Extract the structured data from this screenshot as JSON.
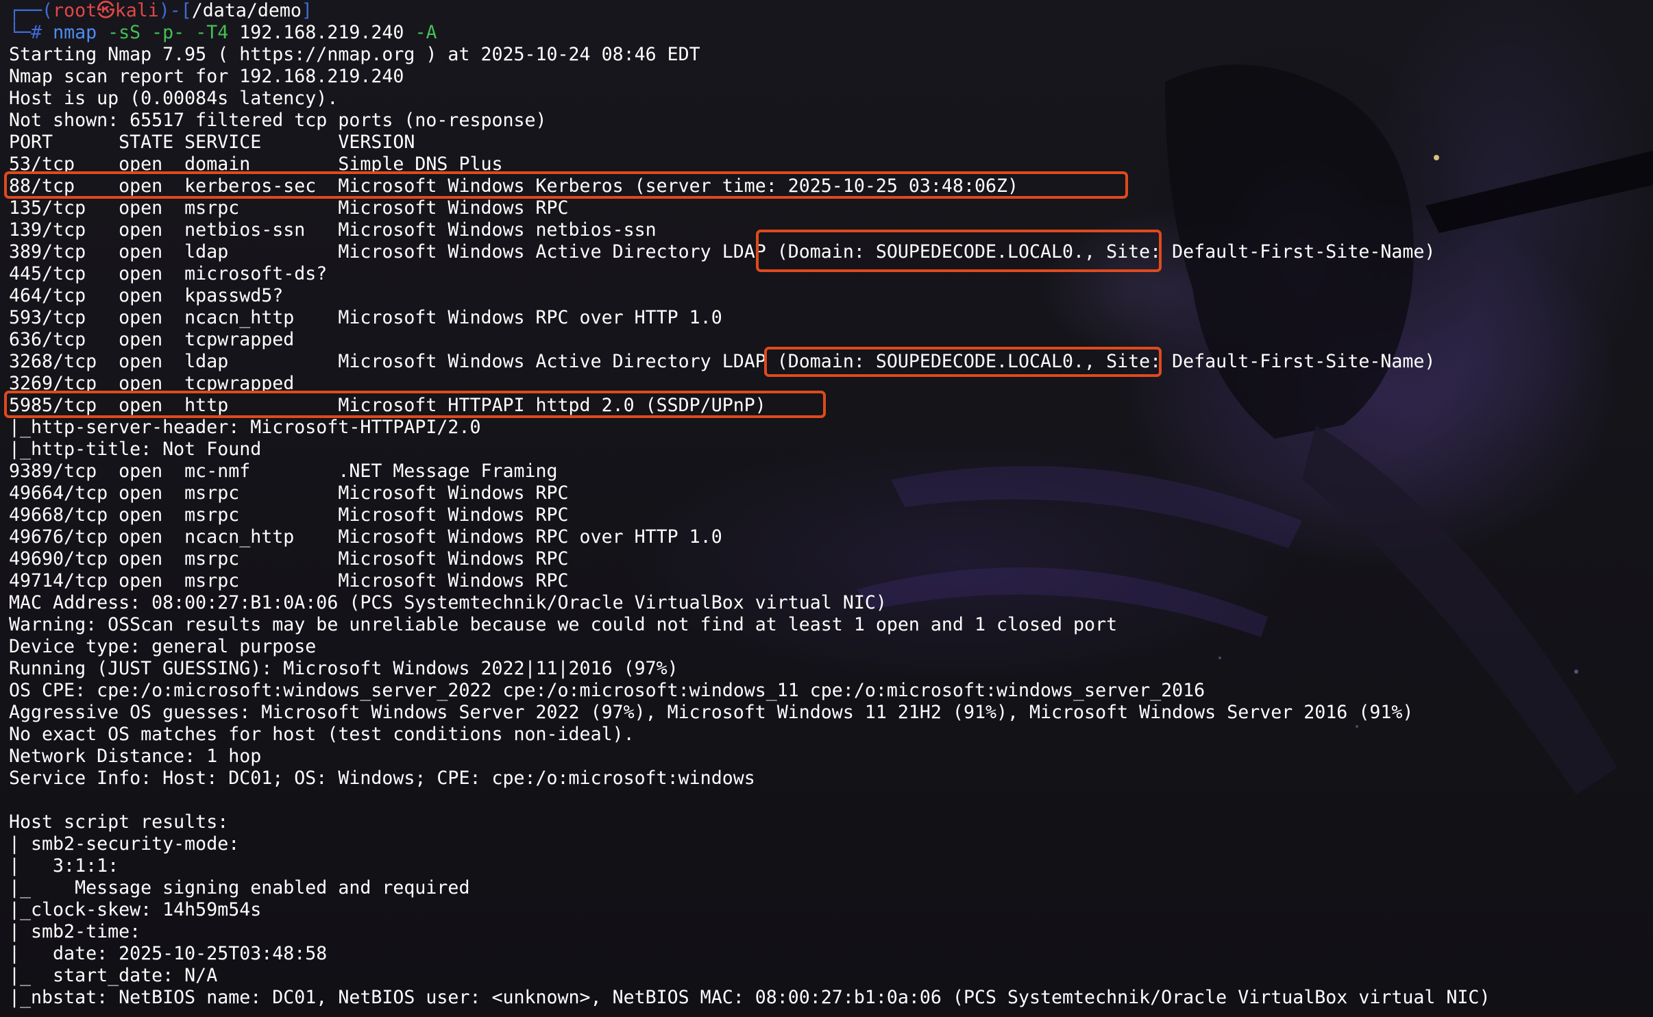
{
  "prompt": {
    "frame_top": "┌──(",
    "user": "root",
    "skull": "㉿",
    "host": "kali",
    "frame_mid": ")-[",
    "path": "/data/demo",
    "frame_end": "]",
    "frame_bottom": "└─",
    "hash": "# ",
    "command": "nmap",
    "flags": " -sS -p- -T4",
    "target": " 192.168.219.240",
    "flag_a": " -A"
  },
  "output_lines": [
    "Starting Nmap 7.95 ( https://nmap.org ) at 2025-10-24 08:46 EDT",
    "Nmap scan report for 192.168.219.240",
    "Host is up (0.00084s latency).",
    "Not shown: 65517 filtered tcp ports (no-response)",
    "PORT      STATE SERVICE       VERSION",
    "53/tcp    open  domain        Simple DNS Plus",
    "88/tcp    open  kerberos-sec  Microsoft Windows Kerberos (server time: 2025-10-25 03:48:06Z)",
    "135/tcp   open  msrpc         Microsoft Windows RPC",
    "139/tcp   open  netbios-ssn   Microsoft Windows netbios-ssn",
    "389/tcp   open  ldap          Microsoft Windows Active Directory LDAP (Domain: SOUPEDECODE.LOCAL0., Site: Default-First-Site-Name)",
    "445/tcp   open  microsoft-ds?",
    "464/tcp   open  kpasswd5?",
    "593/tcp   open  ncacn_http    Microsoft Windows RPC over HTTP 1.0",
    "636/tcp   open  tcpwrapped",
    "3268/tcp  open  ldap          Microsoft Windows Active Directory LDAP (Domain: SOUPEDECODE.LOCAL0., Site: Default-First-Site-Name)",
    "3269/tcp  open  tcpwrapped",
    "5985/tcp  open  http          Microsoft HTTPAPI httpd 2.0 (SSDP/UPnP)",
    "|_http-server-header: Microsoft-HTTPAPI/2.0",
    "|_http-title: Not Found",
    "9389/tcp  open  mc-nmf        .NET Message Framing",
    "49664/tcp open  msrpc         Microsoft Windows RPC",
    "49668/tcp open  msrpc         Microsoft Windows RPC",
    "49676/tcp open  ncacn_http    Microsoft Windows RPC over HTTP 1.0",
    "49690/tcp open  msrpc         Microsoft Windows RPC",
    "49714/tcp open  msrpc         Microsoft Windows RPC",
    "MAC Address: 08:00:27:B1:0A:06 (PCS Systemtechnik/Oracle VirtualBox virtual NIC)",
    "Warning: OSScan results may be unreliable because we could not find at least 1 open and 1 closed port",
    "Device type: general purpose",
    "Running (JUST GUESSING): Microsoft Windows 2022|11|2016 (97%)",
    "OS CPE: cpe:/o:microsoft:windows_server_2022 cpe:/o:microsoft:windows_11 cpe:/o:microsoft:windows_server_2016",
    "Aggressive OS guesses: Microsoft Windows Server 2022 (97%), Microsoft Windows 11 21H2 (91%), Microsoft Windows Server 2016 (91%)",
    "No exact OS matches for host (test conditions non-ideal).",
    "Network Distance: 1 hop",
    "Service Info: Host: DC01; OS: Windows; CPE: cpe:/o:microsoft:windows",
    "",
    "Host script results:",
    "| smb2-security-mode:",
    "|   3:1:1:",
    "|_    Message signing enabled and required",
    "|_clock-skew: 14h59m54s",
    "| smb2-time:",
    "|   date: 2025-10-25T03:48:58",
    "|_  start_date: N/A",
    "|_nbstat: NetBIOS name: DC01, NetBIOS user: <unknown>, NetBIOS MAC: 08:00:27:b1:0a:06 (PCS Systemtechnik/Oracle VirtualBox virtual NIC)"
  ],
  "highlights": [
    {
      "name": "highlight-kerberos-port",
      "line_index": 6
    },
    {
      "name": "highlight-ldap-domain-389",
      "line_index": 9
    },
    {
      "name": "highlight-ldap-domain-3268",
      "line_index": 14
    },
    {
      "name": "highlight-winrm-port",
      "line_index": 16
    }
  ],
  "colors": {
    "background": "#141318",
    "text": "#ffffff",
    "prompt_frame": "#3f6cd8",
    "prompt_user": "#e04848",
    "command": "#4f8cf0",
    "flags": "#44c055",
    "highlight_box": "#e04a1c"
  },
  "wallpaper": {
    "icon": "anime-swordsman-wallpaper"
  }
}
